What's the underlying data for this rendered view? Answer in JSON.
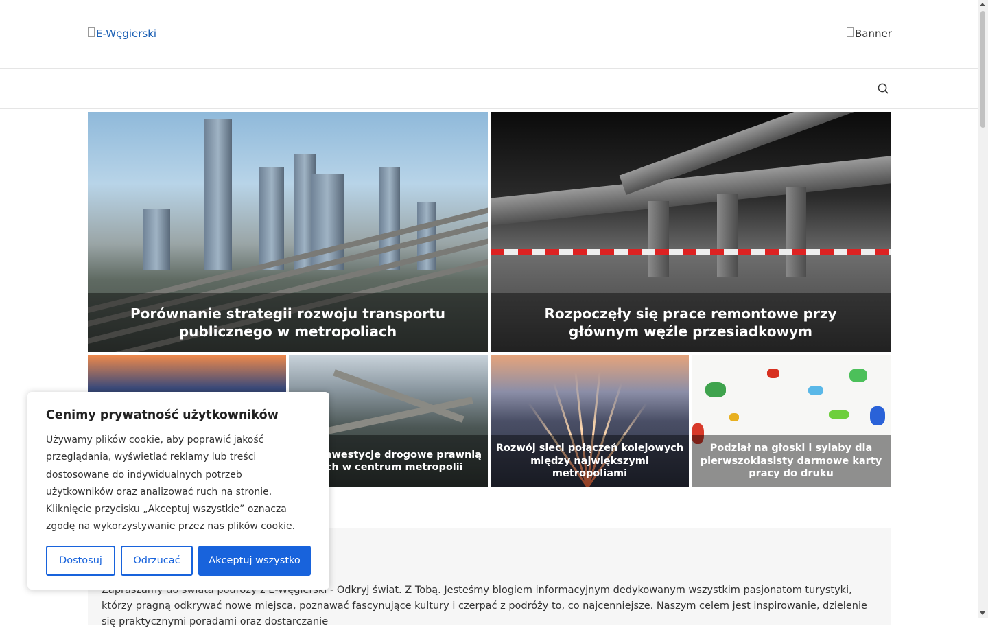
{
  "header": {
    "logo_alt": "E-Węgierski",
    "banner_alt": "Banner"
  },
  "nav": {
    "search_icon": "search-icon"
  },
  "featured": [
    {
      "title": "Porównanie strategii rozwoju transportu publicznego w metropoliach"
    },
    {
      "title": "Rozpoczęły się prace remontowe przy głównym węźle przesiadkowym"
    }
  ],
  "posts": [
    {
      "title": ""
    },
    {
      "title": "owe inwestycje drogowe prawnią ruch w centrum metropolii"
    },
    {
      "title": "Rozwój sieci połączeń kolejowych między największymi metropoliami"
    },
    {
      "title": "Podział na głoski i sylaby dla pierwszoklasisty darmowe karty pracy do druku"
    }
  ],
  "intro": {
    "text": "Zapraszamy do świata podróży z E-Węgierski - Odkryj świat. Z Tobą. Jesteśmy blogiem informacyjnym dedykowanym wszystkim pasjonatom turystyki, którzy pragną odkrywać nowe miejsca, poznawać fascynujące kultury i czerpać z podróży to, co najcenniejsze. Naszym celem jest inspirowanie, dzielenie się praktycznymi poradami oraz dostarczanie"
  },
  "cookie": {
    "title": "Cenimy prywatność użytkowników",
    "body": "Używamy plików cookie, aby poprawić jakość przeglądania, wyświetlać reklamy lub treści dostosowane do indywidualnych potrzeb użytkowników oraz analizować ruch na stronie. Kliknięcie przycisku „Akceptuj wszystkie” oznacza zgodę na wykorzystywanie przez nas plików cookie.",
    "customize_label": "Dostosuj",
    "reject_label": "Odrzucać",
    "accept_label": "Akceptuj wszystko",
    "accent_color": "#1863dc"
  }
}
